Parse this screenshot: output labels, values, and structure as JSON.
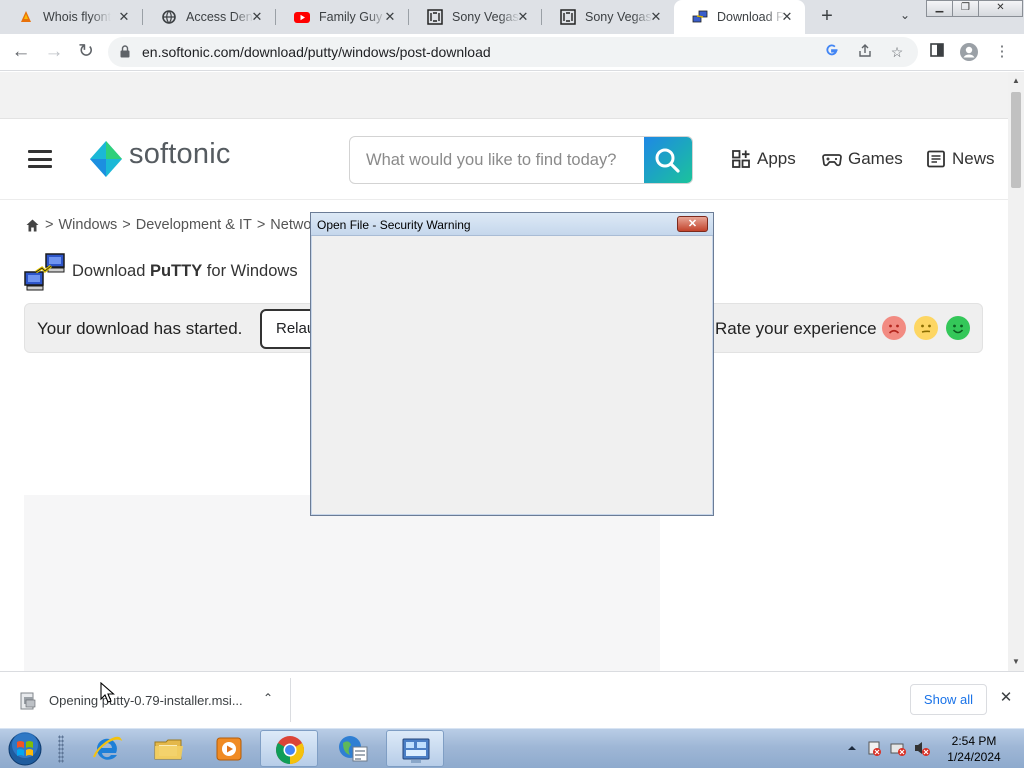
{
  "browser": {
    "tabs": [
      {
        "title": "Whois flyonthe",
        "favicon": "shell-icon",
        "active": false
      },
      {
        "title": "Access Denied",
        "favicon": "globe-icon",
        "active": false
      },
      {
        "title": "Family Guy -",
        "favicon": "youtube-icon",
        "active": false
      },
      {
        "title": "Sony Vegas -",
        "favicon": "wikipedia-icon",
        "active": false
      },
      {
        "title": "Sony Vegas -",
        "favicon": "wikipedia-icon",
        "active": false
      },
      {
        "title": "Download Pu",
        "favicon": "putty-icon",
        "active": true
      }
    ],
    "url": "en.softonic.com/download/putty/windows/post-download"
  },
  "site": {
    "logo": "softonic",
    "search_placeholder": "What would you like to find today?",
    "nav": [
      {
        "label": "Apps",
        "icon": "apps-grid-icon"
      },
      {
        "label": "Games",
        "icon": "gamepad-icon"
      },
      {
        "label": "News",
        "icon": "news-icon"
      }
    ],
    "breadcrumb": [
      ">",
      "Windows",
      ">",
      "Development & IT",
      ">",
      "Network"
    ],
    "product_title_prefix": "Download ",
    "product_name": "PuTTY",
    "product_title_suffix": " for Windows",
    "download_started": "Your download has started.",
    "relaunch_label": "Relaunch",
    "rate_text": "Rate your experience",
    "rating_faces": [
      "sad-face-icon",
      "neutral-face-icon",
      "happy-face-icon"
    ]
  },
  "dialog": {
    "title": "Open File - Security Warning",
    "close": "✕"
  },
  "downloads": {
    "file_status": "Opening putty-0.79-installer.msi...",
    "show_all": "Show all"
  },
  "taskbar": {
    "apps": [
      "ie-icon",
      "explorer-icon",
      "media-player-icon",
      "chrome-icon",
      "network-icon",
      "control-panel-icon"
    ],
    "time": "2:54 PM",
    "date": "1/24/2024"
  },
  "colors": {
    "softonic_accent": "#1bb8d6",
    "search_button": "#1e88e5",
    "show_all_text": "#1a73e8"
  }
}
